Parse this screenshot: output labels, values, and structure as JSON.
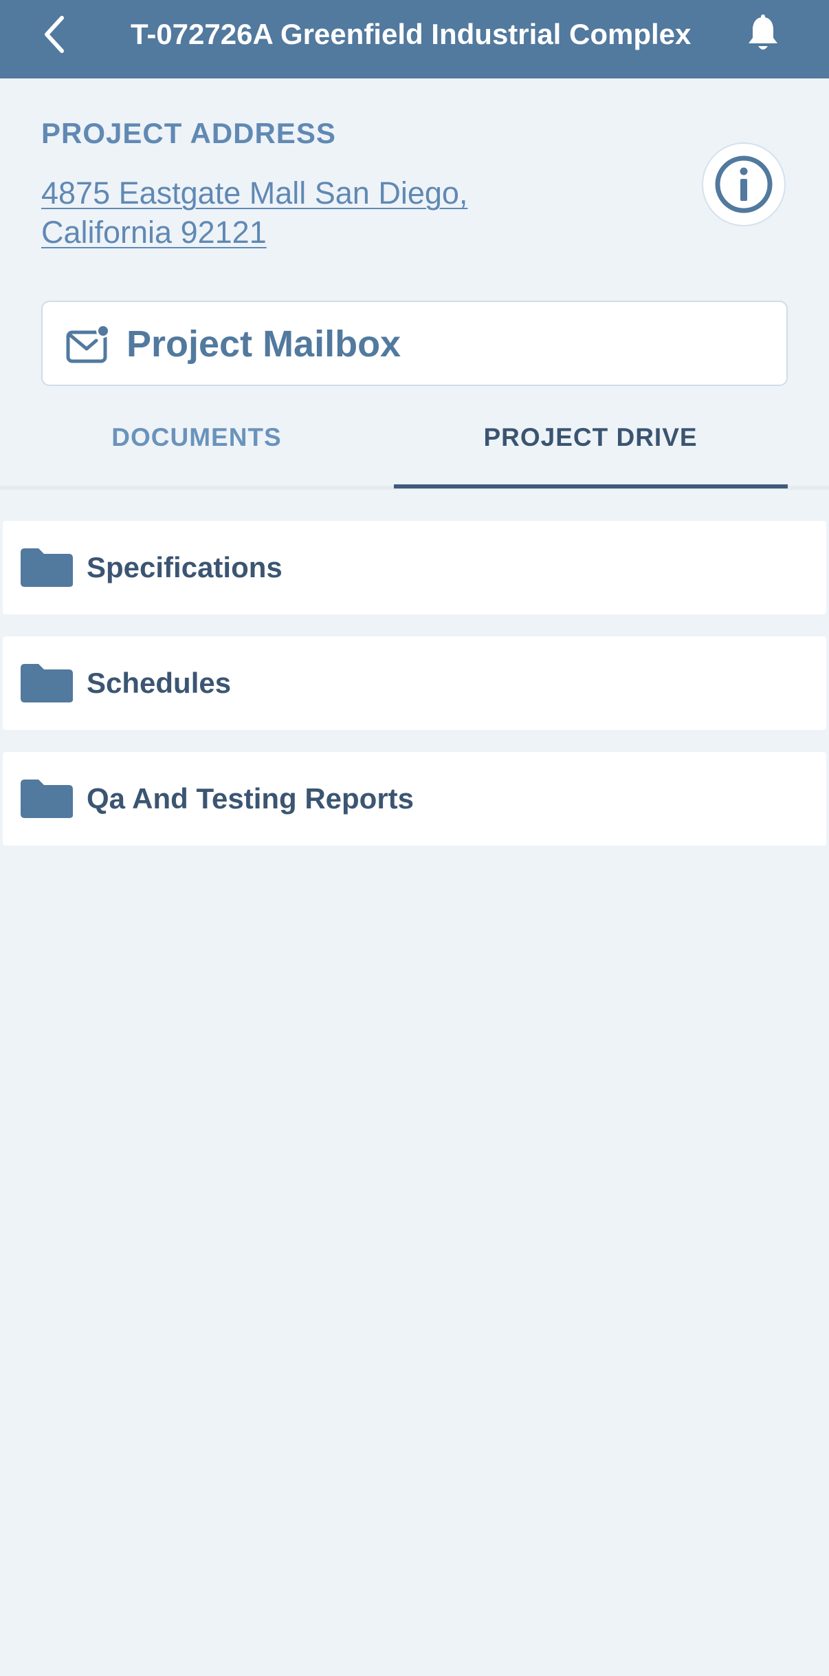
{
  "header": {
    "title": "T-072726A Greenfield Industrial Complex",
    "back_icon": "chevron-left-icon",
    "notifications_icon": "bell-icon"
  },
  "project": {
    "address_label": "PROJECT ADDRESS",
    "address": "4875 Eastgate Mall  San Diego,\nCalifornia 92121",
    "info_icon": "info-icon"
  },
  "mailbox": {
    "label": "Project Mailbox",
    "icon": "mail-unread-icon"
  },
  "tabs": [
    {
      "label": "DOCUMENTS",
      "active": false
    },
    {
      "label": "PROJECT DRIVE",
      "active": true
    }
  ],
  "folders": [
    {
      "label": "Specifications",
      "icon": "folder-icon"
    },
    {
      "label": "Schedules",
      "icon": "folder-icon"
    },
    {
      "label": "Qa And Testing Reports",
      "icon": "folder-icon"
    }
  ],
  "colors": {
    "header_bg": "#52799e",
    "page_bg": "#eef3f8",
    "accent": "#6089b3",
    "folder_icon": "#52799e",
    "text_dark": "#3b5572",
    "tab_inactive": "#6a93bb",
    "tab_active": "#3a5470"
  }
}
